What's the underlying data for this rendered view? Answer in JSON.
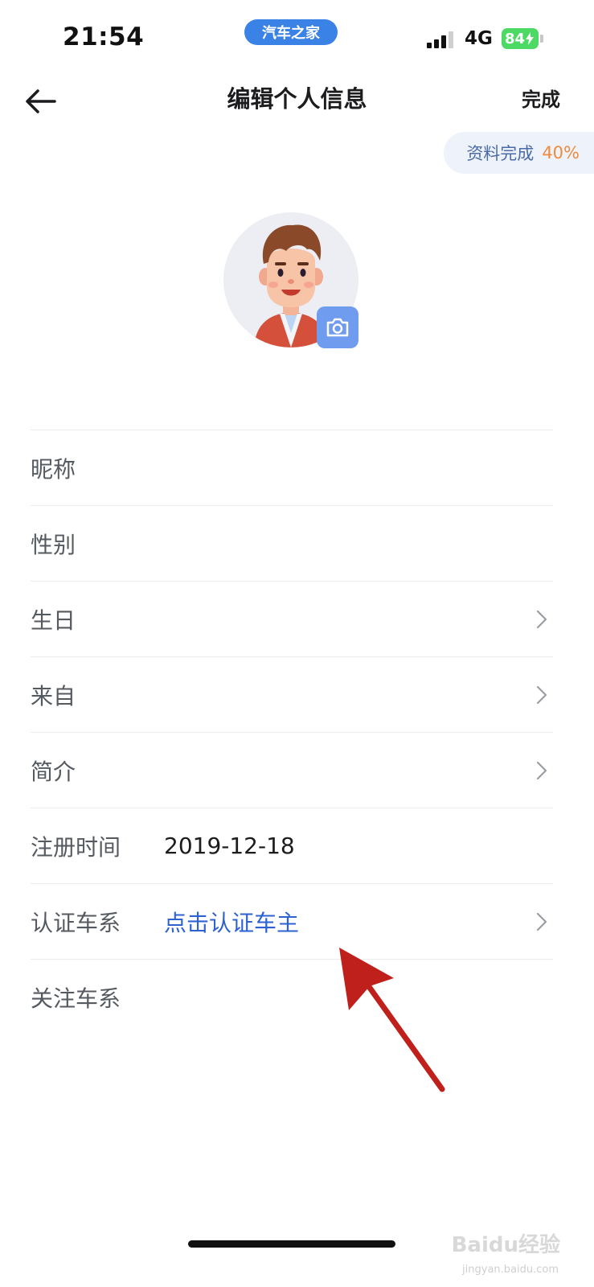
{
  "status_bar": {
    "time": "21:54",
    "app_name": "汽车之家",
    "network": "4G",
    "battery": "84"
  },
  "nav": {
    "title": "编辑个人信息",
    "done_label": "完成"
  },
  "completion": {
    "label": "资料完成",
    "percent": "40%"
  },
  "form": {
    "rows": [
      {
        "label": "昵称",
        "value": ""
      },
      {
        "label": "性别",
        "value": ""
      },
      {
        "label": "生日",
        "value": ""
      },
      {
        "label": "来自",
        "value": ""
      },
      {
        "label": "简介",
        "value": ""
      },
      {
        "label": "注册时间",
        "value": "2019-12-18"
      },
      {
        "label": "认证车系",
        "value": "点击认证车主"
      },
      {
        "label": "关注车系",
        "value": ""
      }
    ]
  },
  "watermark": {
    "text": "Baidu经验",
    "sub": "jingyan.baidu.com"
  },
  "colors": {
    "app_pill": "#3b82e6",
    "link": "#2e62d1",
    "completion_pct": "#f08a3c",
    "camera_button": "#6f9cef",
    "annotation_arrow": "#c0201c"
  }
}
